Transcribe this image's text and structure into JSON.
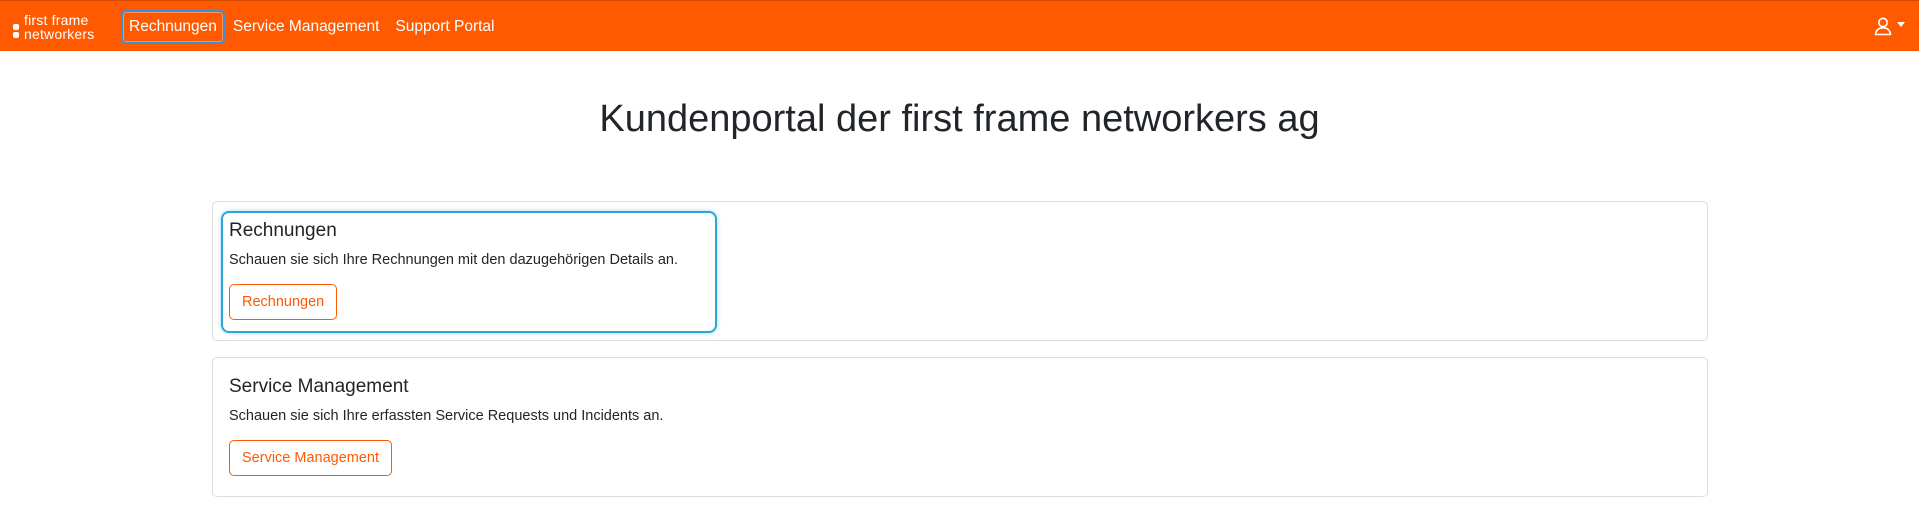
{
  "brand": {
    "line1": "first frame",
    "line2": "networkers"
  },
  "nav": {
    "items": [
      {
        "label": "Rechnungen",
        "active": true
      },
      {
        "label": "Service Management",
        "active": false
      },
      {
        "label": "Support Portal",
        "active": false
      }
    ]
  },
  "user_menu": {
    "icon": "user-icon"
  },
  "page": {
    "title": "Kundenportal der first frame networkers ag"
  },
  "cards": [
    {
      "title": "Rechnungen",
      "text": "Schauen sie sich Ihre Rechnungen mit den dazugehörigen Details an.",
      "button_label": "Rechnungen"
    },
    {
      "title": "Service Management",
      "text": "Schauen sie sich Ihre erfassten Service Requests und Incidents an.",
      "button_label": "Service Management"
    }
  ],
  "colors": {
    "brand_orange": "#ff5a00",
    "focus_blue": "#2aa6d9"
  }
}
